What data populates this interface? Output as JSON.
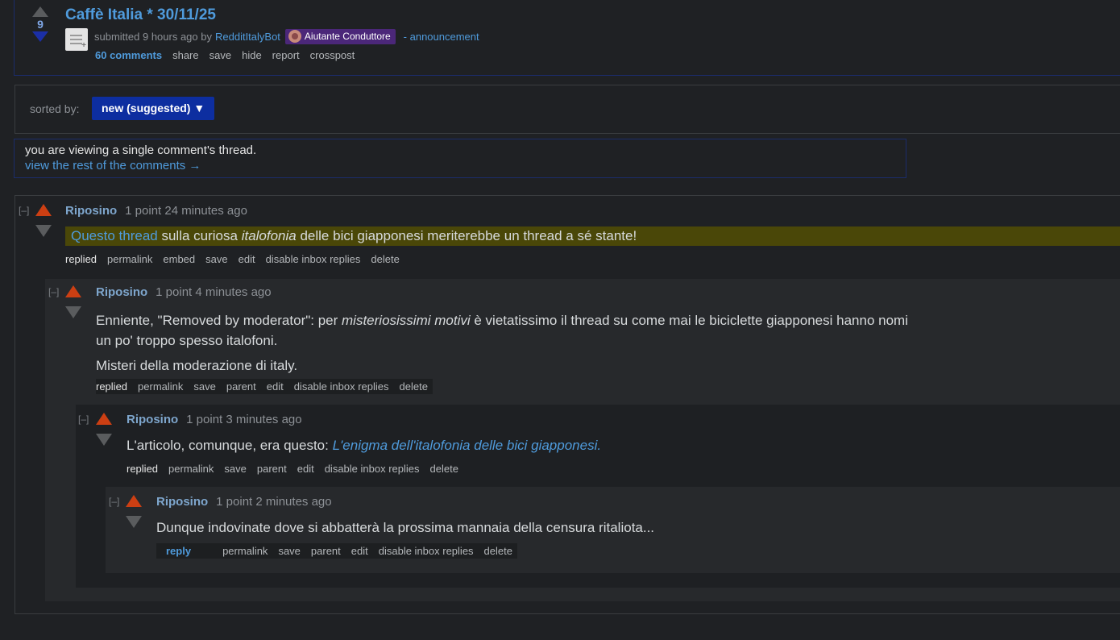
{
  "post": {
    "score": "9",
    "title": "Caffè Italia * 30/11/25",
    "submitted_prefix": "submitted 9 hours ago by",
    "author": "RedditItalyBot",
    "flair": "Aiutante Conduttore",
    "tag": "- announcement",
    "buttons": [
      "60 comments",
      "share",
      "save",
      "hide",
      "report",
      "crosspost"
    ]
  },
  "sort": {
    "label": "sorted by:",
    "value": "new (suggested) ▼"
  },
  "notice": {
    "text": "you are viewing a single comment's thread.",
    "link": "view the rest of the comments →"
  },
  "comments": [
    {
      "collapse": "[–]",
      "author": "Riposino",
      "meta": "1 point 24 minutes ago",
      "body": {
        "link": "Questo thread",
        "t1": " sulla curiosa ",
        "em": "italofonia",
        "t2": " delle bici giapponesi meriterebbe un thread a sé stante!"
      },
      "buttons": [
        "replied",
        "permalink",
        "embed",
        "save",
        "edit",
        "disable inbox replies",
        "delete"
      ]
    },
    {
      "collapse": "[–]",
      "author": "Riposino",
      "meta": "1 point 4 minutes ago",
      "body": {
        "t1": "Enniente, \"Removed by moderator\": per ",
        "em": "misteriosissimi motivi",
        "t2": " è vietatissimo il thread su come mai le biciclette giapponesi hanno nomi",
        "line2": "un po' troppo spesso italofoni.",
        "para2": "Misteri della moderazione di italy."
      },
      "buttons": [
        "replied",
        "permalink",
        "save",
        "parent",
        "edit",
        "disable inbox replies",
        "delete"
      ]
    },
    {
      "collapse": "[–]",
      "author": "Riposino",
      "meta": "1 point 3 minutes ago",
      "body": {
        "t1": "L'articolo, comunque, era questo: ",
        "link": "L'enigma dell'italofonia delle bici giapponesi."
      },
      "buttons": [
        "replied",
        "permalink",
        "save",
        "parent",
        "edit",
        "disable inbox replies",
        "delete"
      ]
    },
    {
      "collapse": "[–]",
      "author": "Riposino",
      "meta": "1 point 2 minutes ago",
      "body": {
        "t1": "Dunque indovinate dove si abbatterà la prossima mannaia della censura ritaliota..."
      },
      "buttons": [
        "reply",
        "permalink",
        "save",
        "parent",
        "edit",
        "disable inbox replies",
        "delete"
      ]
    }
  ],
  "colors": {
    "background": "#1f2124",
    "link": "#4f9bdc",
    "upvote": "#cc3f13",
    "sort_button": "#0d2ea0",
    "flair": "#4b2779",
    "highlight": "#4a4708"
  }
}
